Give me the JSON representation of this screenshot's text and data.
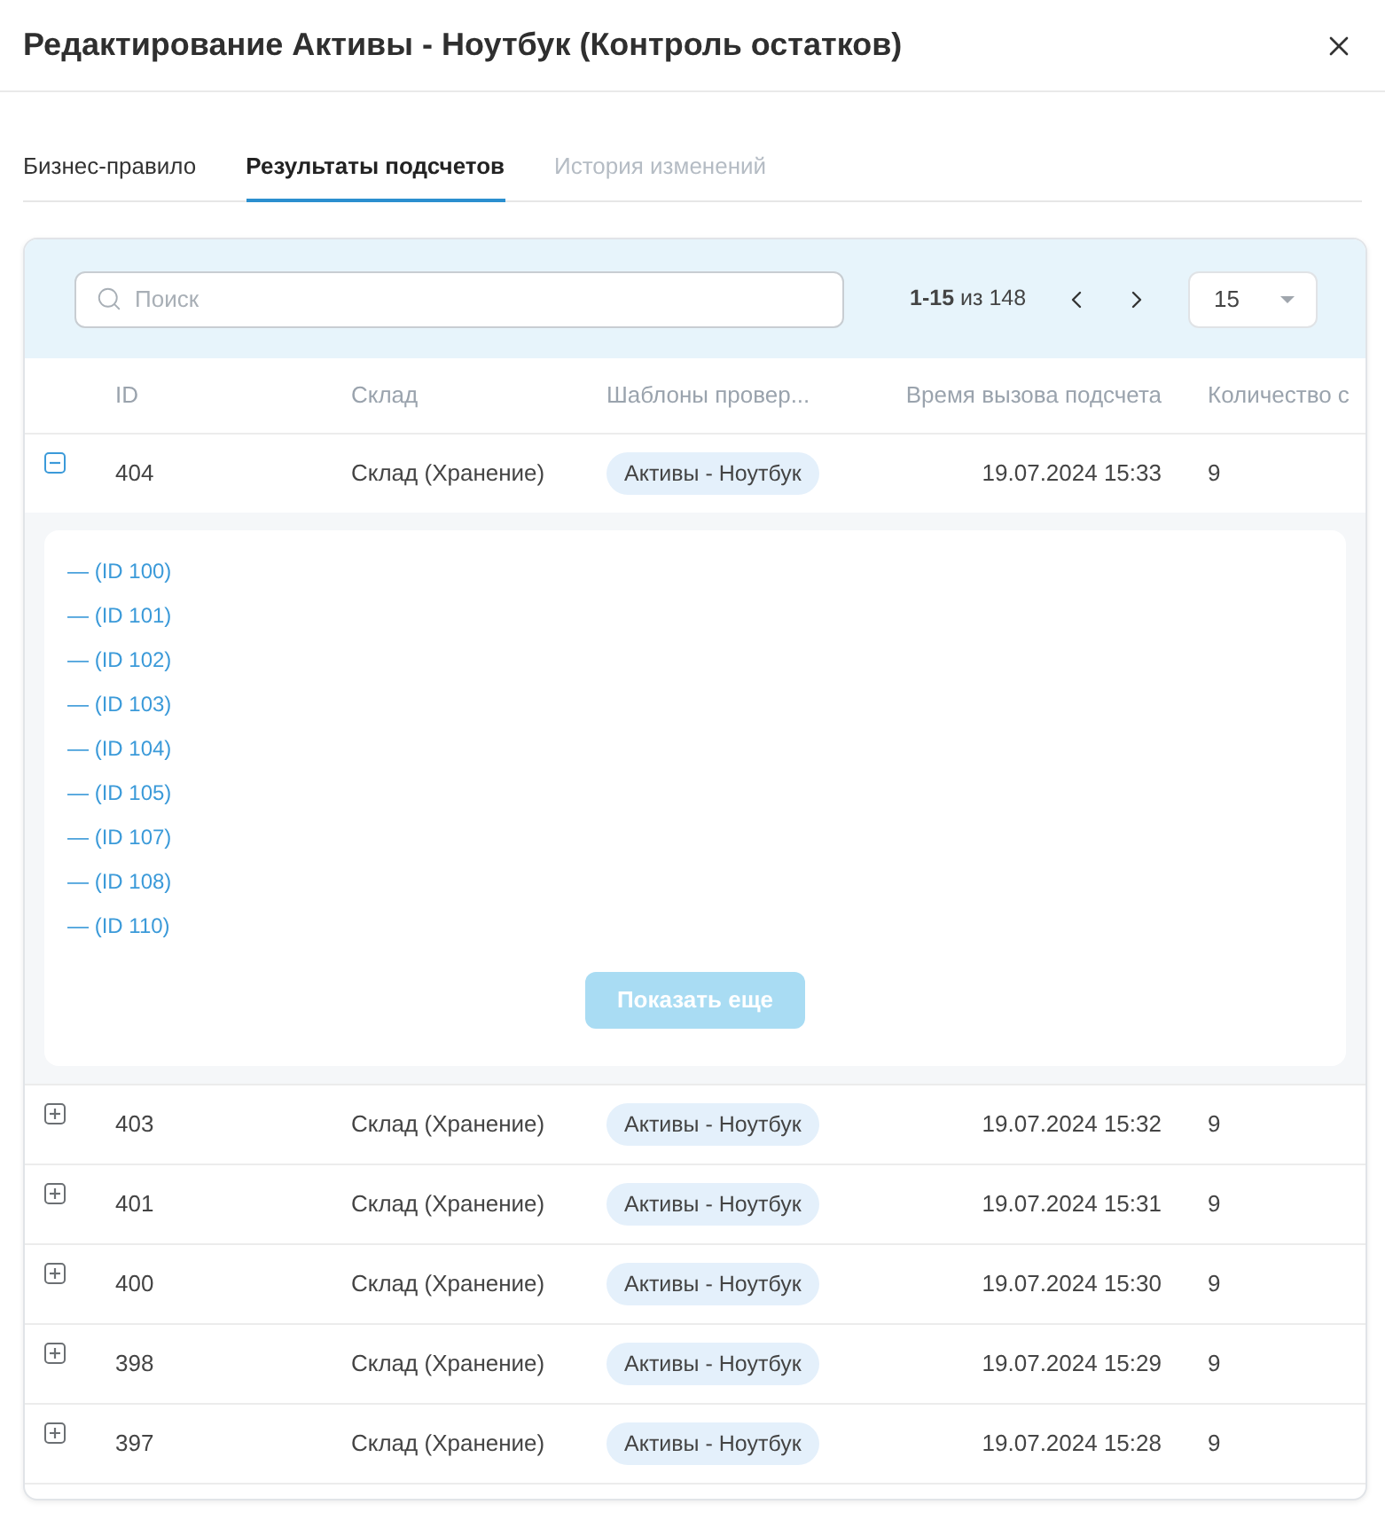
{
  "dialog": {
    "title": "Редактирование Активы - Ноутбук (Контроль остатков)"
  },
  "tabs": [
    {
      "label": "Бизнес-правило",
      "selected": false,
      "disabled": false
    },
    {
      "label": "Результаты подсчетов",
      "selected": true,
      "disabled": false
    },
    {
      "label": "История изменений",
      "selected": false,
      "disabled": true
    }
  ],
  "toolbar": {
    "search": {
      "placeholder": "Поиск"
    },
    "pagination": "**1-15** из 148",
    "page_size": "15"
  },
  "table": {
    "columns": [
      "ID",
      "Склад",
      "Шаблоны провер...",
      "Время вызова подсчета",
      "Количество с"
    ],
    "rows": [
      {
        "id": "404",
        "warehouse": "Склад (Хранение)",
        "template": "Активы - Ноутбук",
        "called_at": "19.07.2024 15:33",
        "count": "9",
        "expanded": true,
        "details": {
          "items": [
            "— (ID 100)",
            "— (ID 101)",
            "— (ID 102)",
            "— (ID 103)",
            "— (ID 104)",
            "— (ID 105)",
            "— (ID 107)",
            "— (ID 108)",
            "— (ID 110)"
          ],
          "show_more": {
            "label": "Показать еще",
            "disabled": true
          }
        }
      },
      {
        "id": "403",
        "warehouse": "Склад (Хранение)",
        "template": "Активы - Ноутбук",
        "called_at": "19.07.2024 15:32",
        "count": "9",
        "expanded": false
      },
      {
        "id": "401",
        "warehouse": "Склад (Хранение)",
        "template": "Активы - Ноутбук",
        "called_at": "19.07.2024 15:31",
        "count": "9",
        "expanded": false
      },
      {
        "id": "400",
        "warehouse": "Склад (Хранение)",
        "template": "Активы - Ноутбук",
        "called_at": "19.07.2024 15:30",
        "count": "9",
        "expanded": false
      },
      {
        "id": "398",
        "warehouse": "Склад (Хранение)",
        "template": "Активы - Ноутбук",
        "called_at": "19.07.2024 15:29",
        "count": "9",
        "expanded": false
      },
      {
        "id": "397",
        "warehouse": "Склад (Хранение)",
        "template": "Активы - Ноутбук",
        "called_at": "19.07.2024 15:28",
        "count": "9",
        "expanded": false
      }
    ]
  }
}
